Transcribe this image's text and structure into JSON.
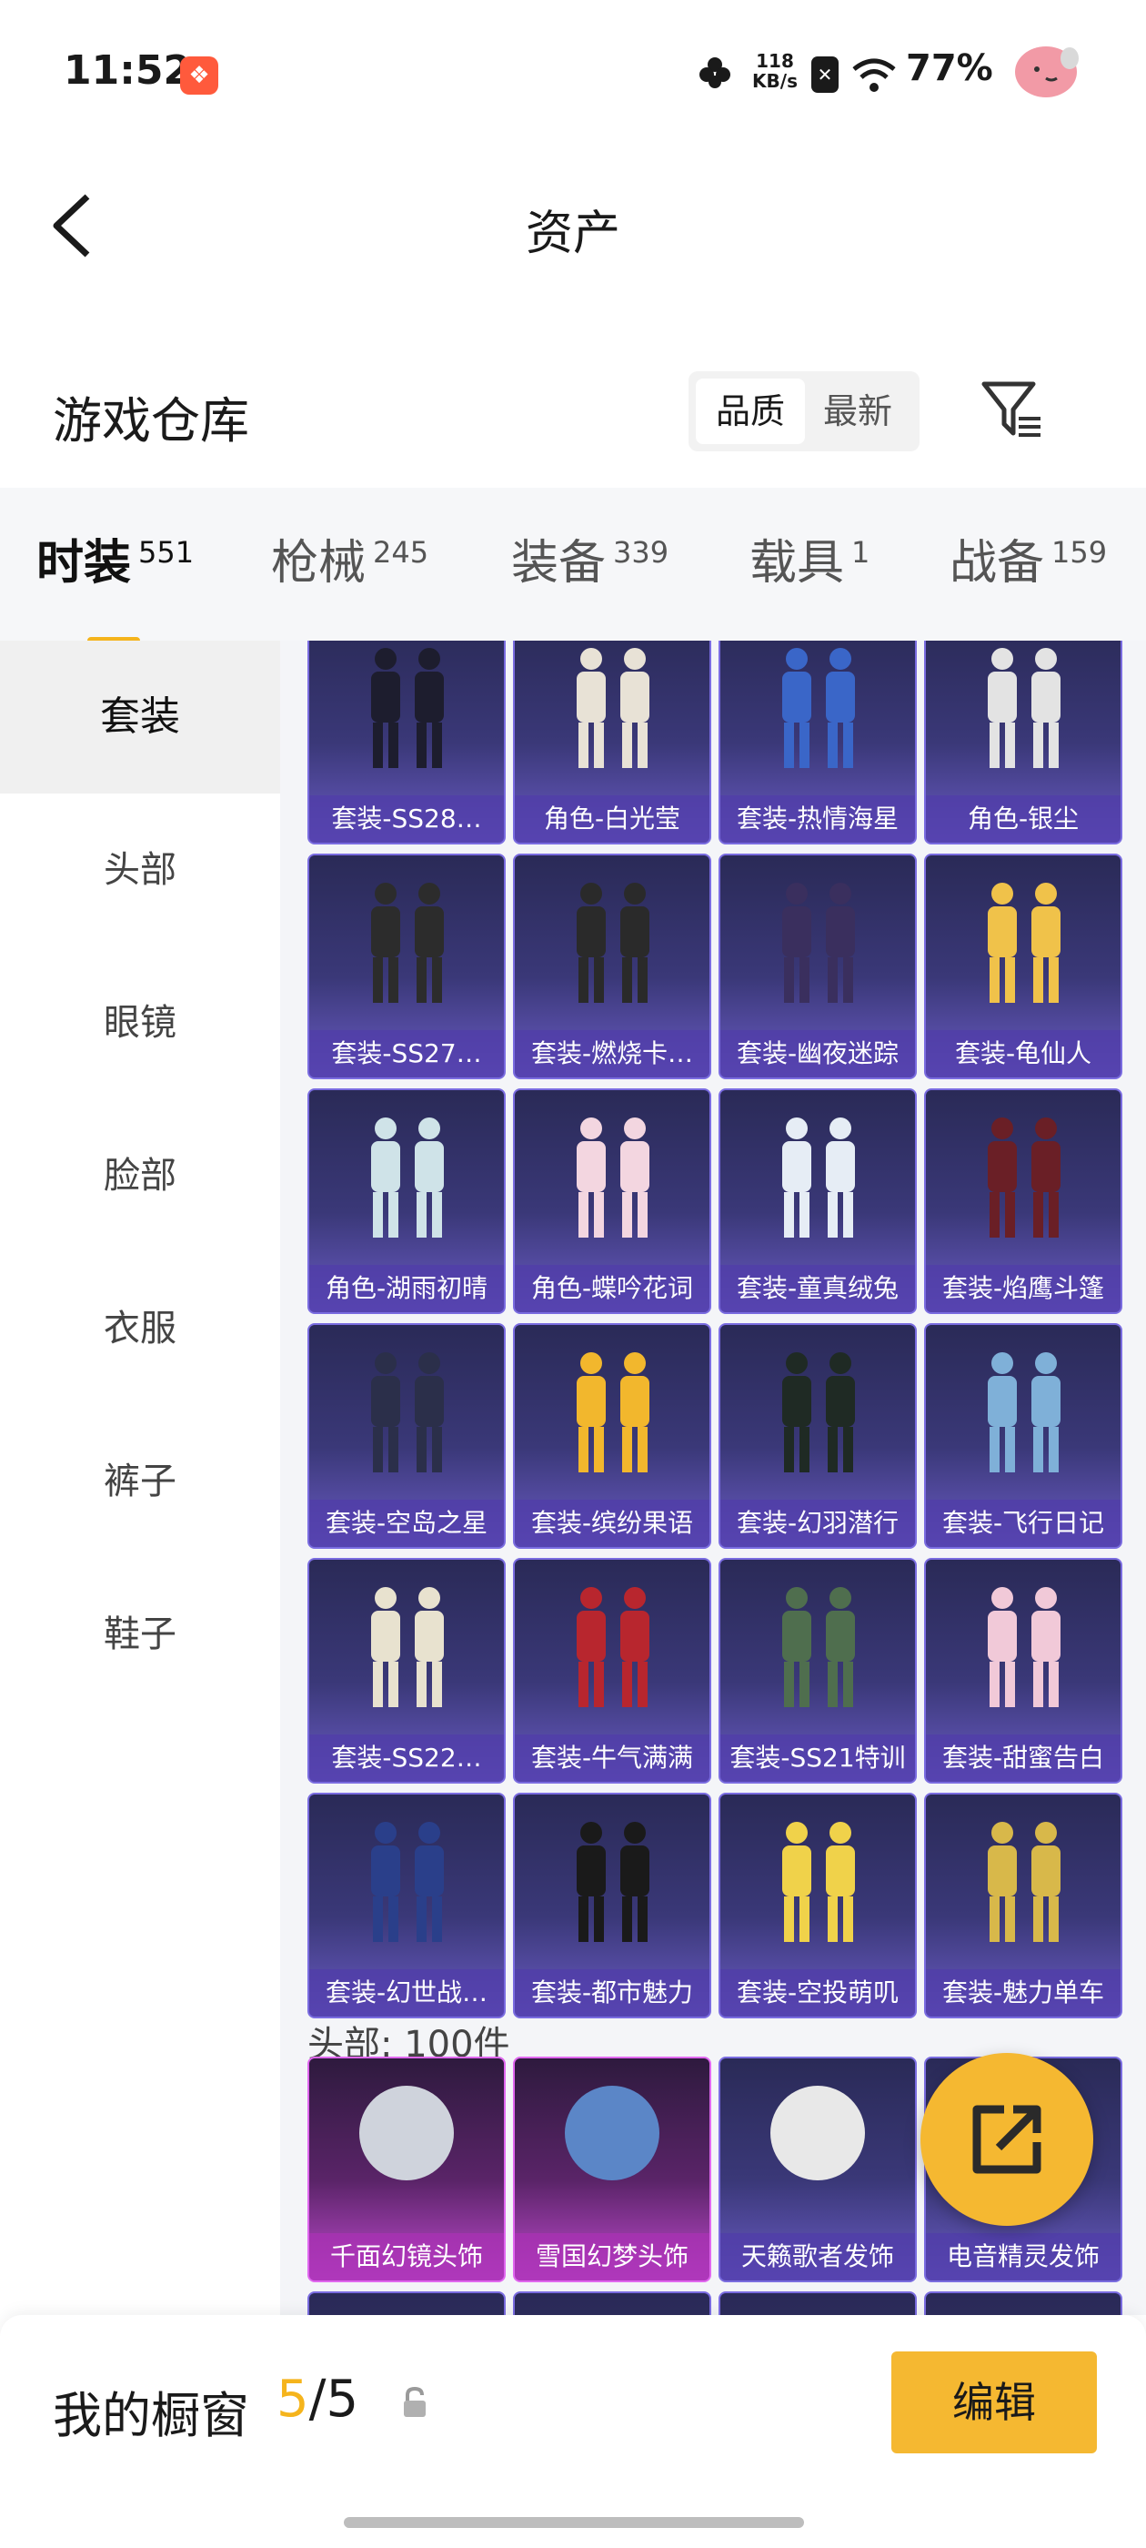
{
  "status_bar": {
    "time": "11:52",
    "net_speed_value": "118",
    "net_speed_unit": "KB/s",
    "battery": "77%",
    "app_icon": "app-badge-icon"
  },
  "header": {
    "title": "资产"
  },
  "warehouse": {
    "title": "游戏仓库",
    "sort_options": [
      "品质",
      "最新"
    ],
    "sort_active": "品质"
  },
  "tabs": [
    {
      "label": "时装",
      "count": "551",
      "active": true
    },
    {
      "label": "枪械",
      "count": "245",
      "active": false
    },
    {
      "label": "装备",
      "count": "339",
      "active": false
    },
    {
      "label": "载具",
      "count": "1",
      "active": false
    },
    {
      "label": "战备",
      "count": "159",
      "active": false
    }
  ],
  "sidebar": {
    "items": [
      "套装",
      "头部",
      "眼镜",
      "脸部",
      "衣服",
      "裤子",
      "鞋子"
    ],
    "active": "套装"
  },
  "grid": {
    "items": [
      "套装-SS28…",
      "角色-白光莹",
      "套装-热情海星",
      "角色-银尘",
      "套装-SS27…",
      "套装-燃烧卡…",
      "套装-幽夜迷踪",
      "套装-龟仙人",
      "角色-湖雨初晴",
      "角色-蝶吟花词",
      "套装-童真绒兔",
      "套装-焰鹰斗篷",
      "套装-空岛之星",
      "套装-缤纷果语",
      "套装-幻羽潜行",
      "套装-飞行日记",
      "套装-SS22…",
      "套装-牛气满满",
      "套装-SS21特训",
      "套装-甜蜜告白",
      "套装-幻世战…",
      "套装-都市魅力",
      "套装-空投萌叽",
      "套装-魅力单车"
    ],
    "head_section_title": "头部: 100件",
    "head_items": [
      "千面幻镜头饰",
      "雪国幻梦头饰",
      "天籁歌者发饰",
      "电音精灵发饰"
    ]
  },
  "bottom": {
    "label": "我的橱窗",
    "current": "5",
    "total": "/5",
    "edit_label": "编辑"
  },
  "colors": {
    "accent": "#f5b831",
    "card_purple": "#3a3878",
    "card_pink": "#c14ad0"
  }
}
